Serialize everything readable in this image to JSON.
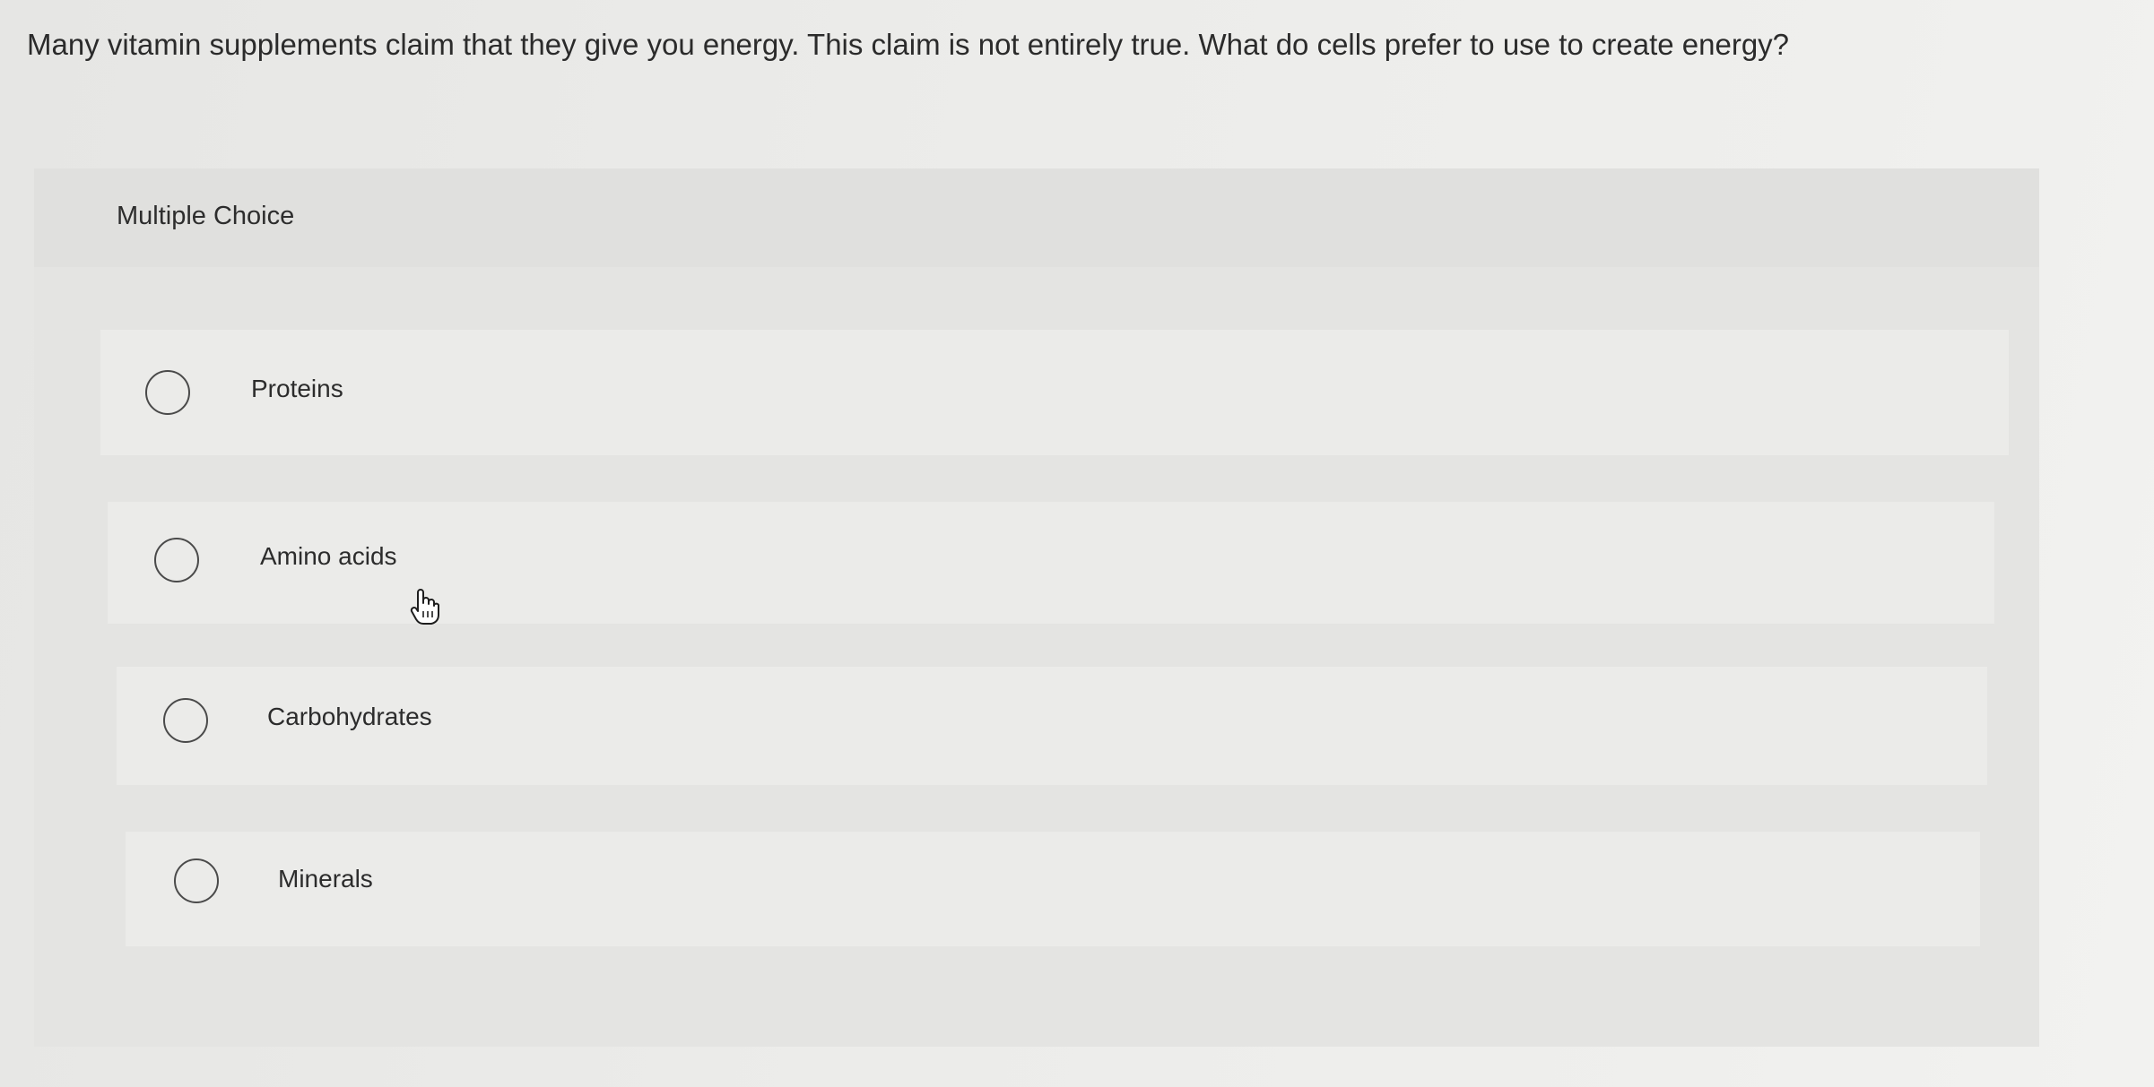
{
  "question": {
    "text": "Many vitamin supplements claim that they give you energy. This claim is not entirely true. What do cells prefer to use to create energy?"
  },
  "quiz": {
    "type_label": "Multiple Choice",
    "options": [
      {
        "label": "Proteins",
        "selected": false
      },
      {
        "label": "Amino acids",
        "selected": false
      },
      {
        "label": "Carbohydrates",
        "selected": false
      },
      {
        "label": "Minerals",
        "selected": false
      }
    ]
  },
  "icons": {
    "radio": "radio-button-icon",
    "cursor": "hand-pointer-cursor-icon"
  }
}
